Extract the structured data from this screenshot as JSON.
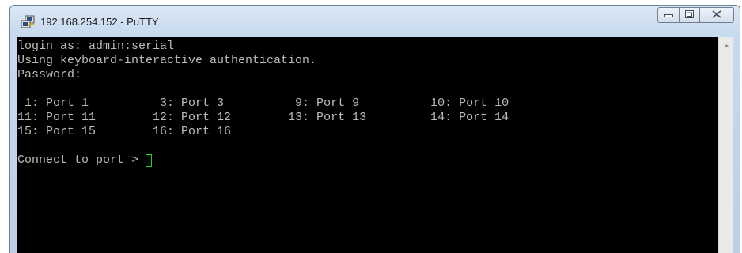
{
  "window": {
    "title": "192.168.254.152 - PuTTY",
    "icon": "putty-icon"
  },
  "controls": {
    "minimize_icon": "minimize-icon",
    "maximize_icon": "maximize-icon",
    "close_icon": "close-icon"
  },
  "terminal": {
    "lines": [
      "login as: admin:serial",
      "Using keyboard-interactive authentication.",
      "Password:",
      "",
      " 1: Port 1          3: Port 3          9: Port 9          10: Port 10",
      "11: Port 11        12: Port 12        13: Port 13         14: Port 14",
      "15: Port 15        16: Port 16",
      "",
      "Connect to port > "
    ],
    "text_color": "#bbbbbb",
    "background": "#000000",
    "cursor_color": "#18d818"
  },
  "scrollbar": {
    "up_icon": "scroll-up-arrow-icon"
  }
}
